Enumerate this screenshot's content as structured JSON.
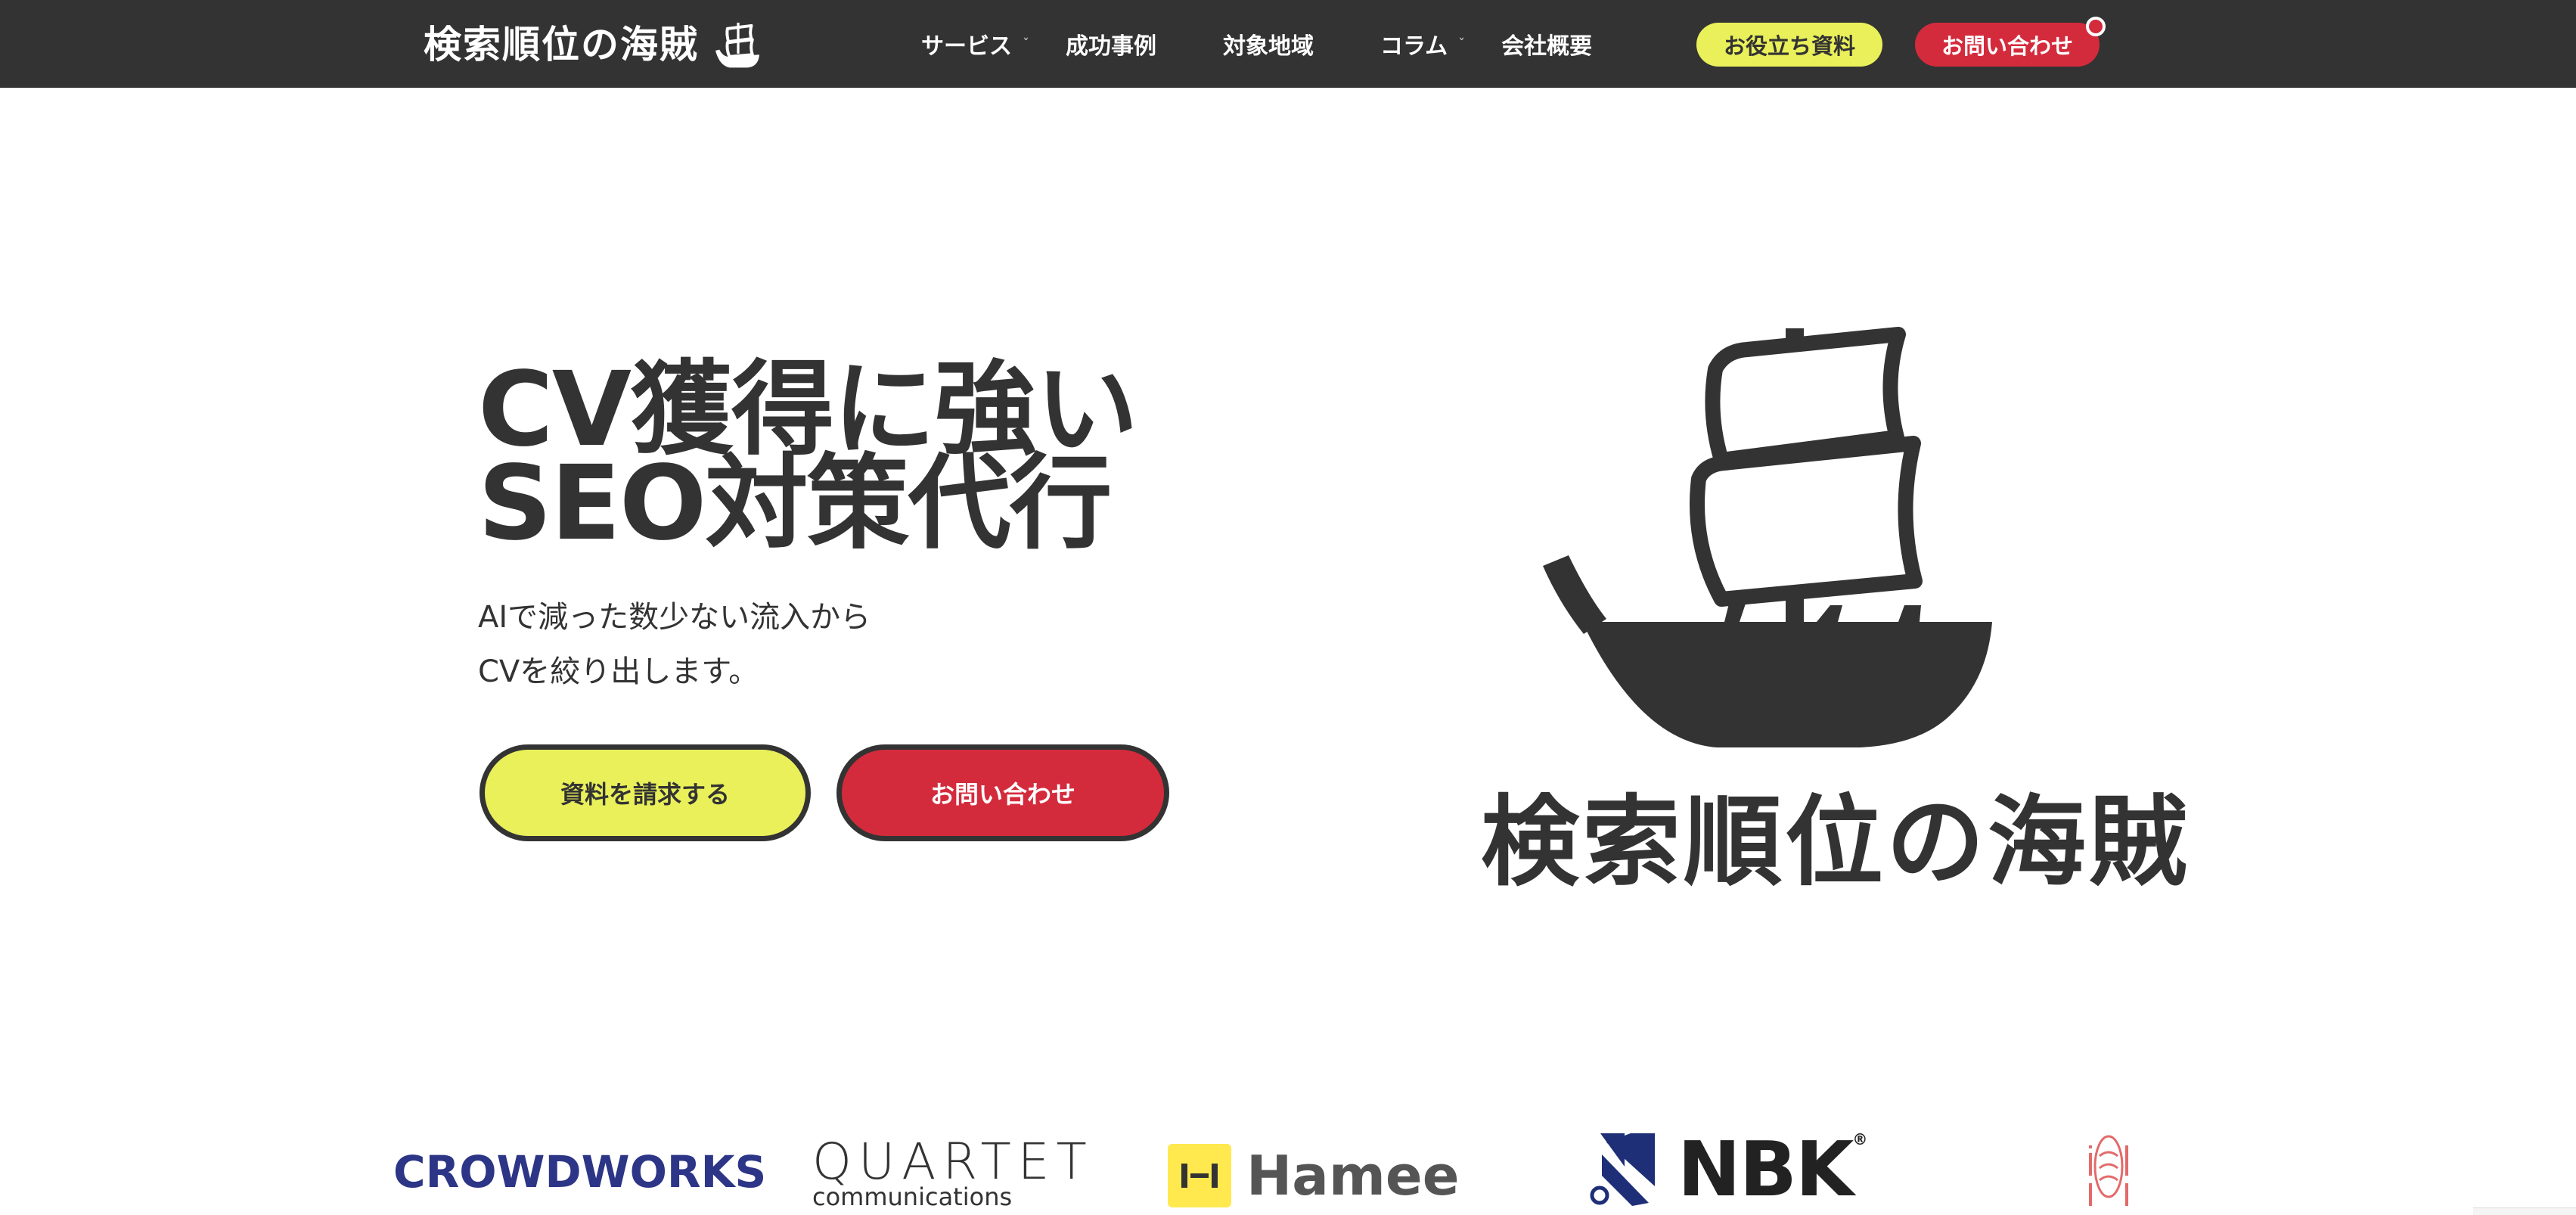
{
  "header": {
    "brand": "検索順位の海賊",
    "brand_icon": "ship-icon",
    "nav": [
      {
        "label": "サービス",
        "has_dropdown": true
      },
      {
        "label": "成功事例",
        "has_dropdown": false
      },
      {
        "label": "対象地域",
        "has_dropdown": false
      },
      {
        "label": "コラム",
        "has_dropdown": true
      },
      {
        "label": "会社概要",
        "has_dropdown": false
      }
    ],
    "caret": "ˇ",
    "resources_button": "お役立ち資料",
    "contact_button": "お問い合わせ"
  },
  "hero": {
    "title_line1": "CV獲得に強い",
    "title_line2": "SEO対策代行",
    "subtitle_line1": "AIで減った数少ない流入から",
    "subtitle_line2": "CVを絞り出します。",
    "cta_primary": "資料を請求する",
    "cta_secondary": "お問い合わせ",
    "brand_text": "検索順位の海賊",
    "brand_icon": "ship-icon"
  },
  "logos": {
    "crowdworks": "CROWDWORKS",
    "quartet_main": "QUARTET",
    "quartet_sub": "communications",
    "hamee": "Hamee",
    "nbk": "NBK",
    "nbk_reg": "®"
  },
  "colors": {
    "header_bg": "#333333",
    "accent_yellow": "#e9f05a",
    "accent_red": "#d42b3c",
    "text": "#333333"
  }
}
